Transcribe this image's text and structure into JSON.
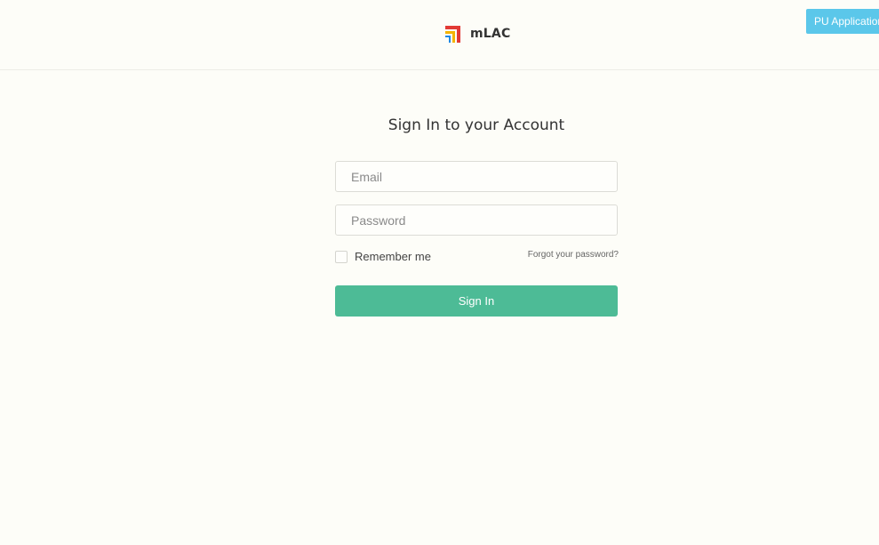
{
  "header": {
    "brand_name": "mLAC",
    "logo_icon": "mlac-logo-icon",
    "pu_button_label": "PU Application"
  },
  "login": {
    "title": "Sign In to your Account",
    "email_placeholder": "Email",
    "email_value": "",
    "password_placeholder": "Password",
    "password_value": "",
    "remember_label": "Remember me",
    "remember_checked": false,
    "forgot_label": "Forgot your password?",
    "signin_label": "Sign In"
  },
  "colors": {
    "background": "#fdfdf8",
    "primary_button": "#4dbb96",
    "pu_button": "#5bc7ea",
    "logo_red": "#e23a35",
    "logo_yellow": "#f4b400",
    "logo_blue": "#1e88e5"
  }
}
